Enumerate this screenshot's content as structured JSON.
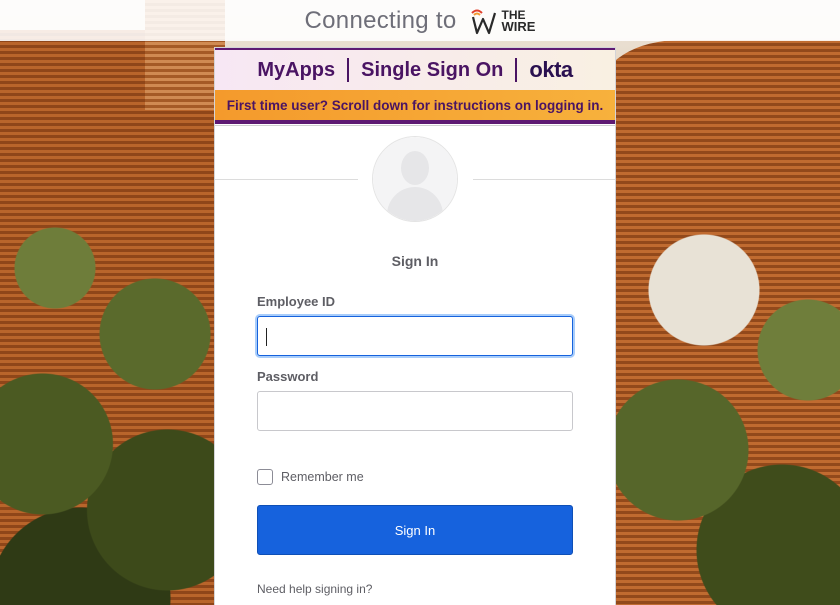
{
  "topbar": {
    "connecting_text": "Connecting to",
    "logo": {
      "icon": "the-wire-logo-icon",
      "line1": "THE",
      "line2": "WIRE"
    }
  },
  "banner": {
    "brand_myapps": "MyApps",
    "brand_sso": "Single Sign On",
    "brand_okta": "okta",
    "instructions": "First time user? Scroll down for instructions on logging in."
  },
  "avatar": {
    "icon": "user-avatar-icon"
  },
  "form": {
    "title": "Sign In",
    "employee_id_label": "Employee ID",
    "employee_id_value": "",
    "password_label": "Password",
    "password_value": "",
    "remember_label": "Remember me",
    "remember_checked": false,
    "submit_label": "Sign In",
    "help_link": "Need help signing in?"
  },
  "colors": {
    "primary_button": "#1662dd",
    "banner_purple": "#4a1463",
    "banner_orange": "#f49a2c",
    "focus_ring": "#a9cdfa"
  }
}
